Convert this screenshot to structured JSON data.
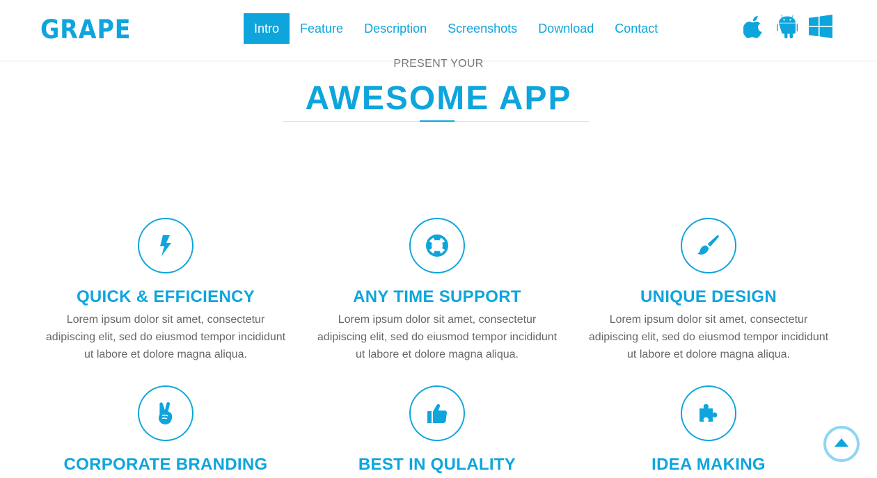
{
  "brand": {
    "logo": "GRAPE",
    "accent_color": "#0ea5dd"
  },
  "nav": {
    "items": [
      {
        "label": "Intro",
        "active": true
      },
      {
        "label": "Feature",
        "active": false
      },
      {
        "label": "Description",
        "active": false
      },
      {
        "label": "Screenshots",
        "active": false
      },
      {
        "label": "Download",
        "active": false
      },
      {
        "label": "Contact",
        "active": false
      }
    ]
  },
  "platforms": [
    {
      "icon": "apple-icon"
    },
    {
      "icon": "android-icon"
    },
    {
      "icon": "windows-icon"
    }
  ],
  "intro": {
    "kicker": "PRESENT YOUR",
    "title": "AWESOME APP"
  },
  "features": [
    {
      "icon": "lightning-icon",
      "title": "QUICK & EFFICIENCY",
      "text": "Lorem ipsum dolor sit amet, consectetur adipiscing elit, sed do eiusmod tempor incididunt ut labore et dolore magna aliqua."
    },
    {
      "icon": "lifebuoy-icon",
      "title": "ANY TIME SUPPORT",
      "text": "Lorem ipsum dolor sit amet, consectetur adipiscing elit, sed do eiusmod tempor incididunt ut labore et dolore magna aliqua."
    },
    {
      "icon": "paintbrush-icon",
      "title": "UNIQUE DESIGN",
      "text": "Lorem ipsum dolor sit amet, consectetur adipiscing elit, sed do eiusmod tempor incididunt ut labore et dolore magna aliqua."
    },
    {
      "icon": "peace-hand-icon",
      "title": "CORPORATE BRANDING",
      "text": ""
    },
    {
      "icon": "thumbs-up-icon",
      "title": "BEST IN QULALITY",
      "text": ""
    },
    {
      "icon": "puzzle-icon",
      "title": "IDEA MAKING",
      "text": ""
    }
  ],
  "scroll_top": {
    "icon": "caret-up-icon"
  }
}
